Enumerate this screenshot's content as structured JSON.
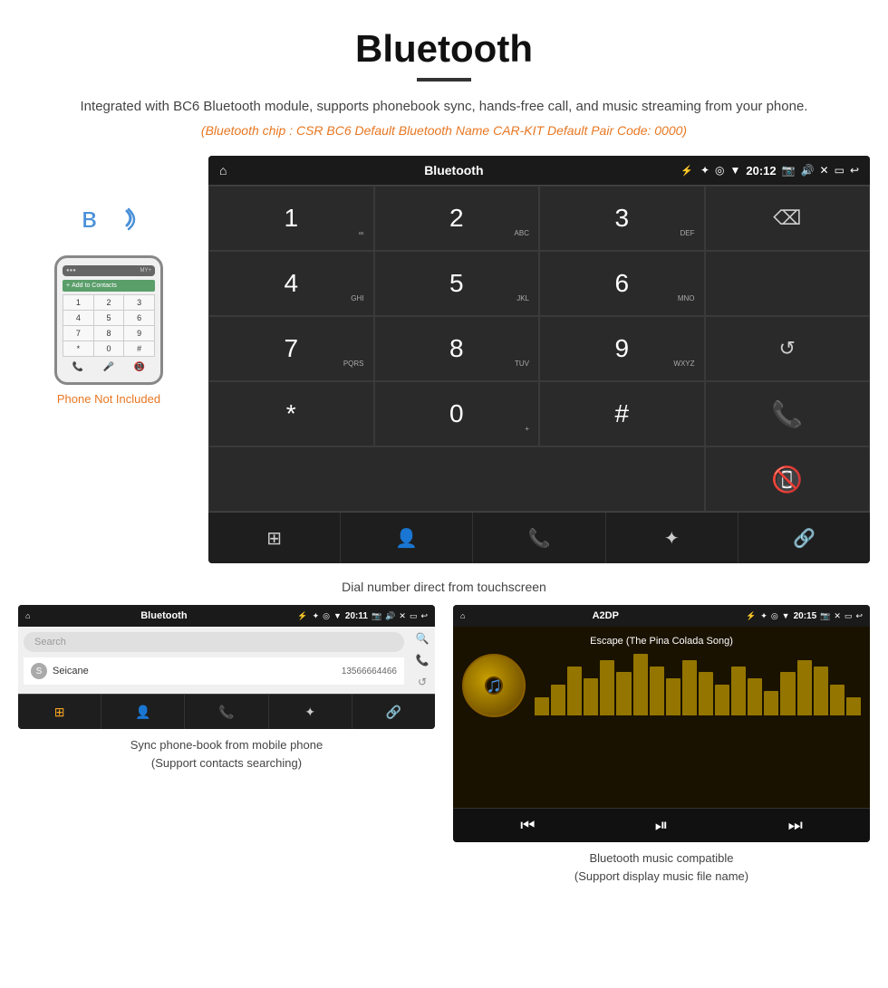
{
  "page": {
    "title": "Bluetooth",
    "subtitle": "Integrated with BC6 Bluetooth module, supports phonebook sync, hands-free call, and music streaming from your phone.",
    "specs": "(Bluetooth chip : CSR BC6    Default Bluetooth Name CAR-KIT    Default Pair Code: 0000)",
    "phone_note": "Phone Not Included",
    "main_caption": "Dial number direct from touchscreen",
    "caption_left": "Sync phone-book from mobile phone\n(Support contacts searching)",
    "caption_right": "Bluetooth music compatible\n(Support display music file name)"
  },
  "main_screen": {
    "app_title": "Bluetooth",
    "time": "20:12",
    "status_icons": [
      "✦",
      "◎",
      "▼"
    ],
    "dialpad": [
      {
        "label": "1",
        "sub": "∞"
      },
      {
        "label": "2",
        "sub": "ABC"
      },
      {
        "label": "3",
        "sub": "DEF"
      },
      {
        "label": "⌫",
        "type": "backspace"
      },
      {
        "label": "4",
        "sub": "GHI"
      },
      {
        "label": "5",
        "sub": "JKL"
      },
      {
        "label": "6",
        "sub": "MNO"
      },
      {
        "label": "",
        "type": "empty"
      },
      {
        "label": "7",
        "sub": "PQRS"
      },
      {
        "label": "8",
        "sub": "TUV"
      },
      {
        "label": "9",
        "sub": "WXYZ"
      },
      {
        "label": "↺",
        "type": "refresh"
      },
      {
        "label": "*",
        "sub": ""
      },
      {
        "label": "0",
        "sub": "+"
      },
      {
        "label": "#",
        "sub": ""
      },
      {
        "label": "📞",
        "type": "call-green"
      },
      {
        "label": "🔴",
        "type": "call-red"
      }
    ],
    "bottom_buttons": [
      "⊞",
      "👤",
      "📞",
      "✦",
      "🔗"
    ]
  },
  "phonebook_screen": {
    "app_title": "Bluetooth",
    "time": "20:11",
    "search_placeholder": "Search",
    "contacts": [
      {
        "initial": "S",
        "name": "Seicane",
        "number": "13566664466"
      }
    ],
    "bottom_buttons": [
      "⊞",
      "👤",
      "📞",
      "✦",
      "🔗"
    ]
  },
  "music_screen": {
    "app_title": "A2DP",
    "time": "20:15",
    "song_title": "Escape (The Pina Colada Song)",
    "eq_bars": [
      3,
      5,
      8,
      6,
      9,
      7,
      10,
      8,
      6,
      9,
      7,
      5,
      8,
      6,
      4,
      7,
      9,
      8,
      5,
      3
    ],
    "controls": [
      "⏮",
      "⏯",
      "⏭"
    ]
  },
  "phone_keys": [
    "1",
    "2",
    "3",
    "4",
    "5",
    "6",
    "7",
    "8",
    "9",
    "*",
    "0",
    "#"
  ]
}
